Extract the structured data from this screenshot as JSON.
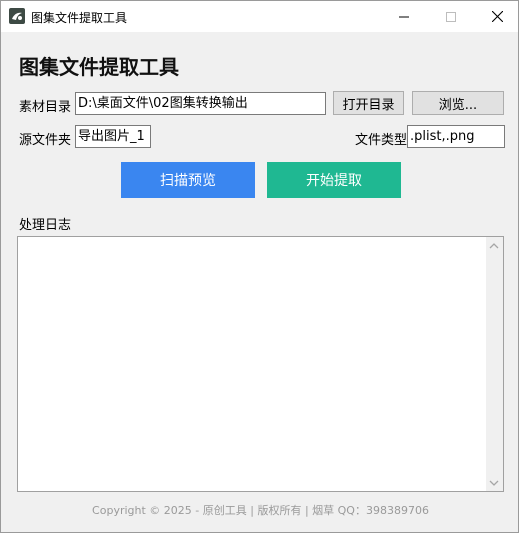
{
  "window": {
    "title": "图集文件提取工具"
  },
  "heading": "图集文件提取工具",
  "material_dir": {
    "label": "素材目录",
    "value": "D:\\桌面文件\\02图集转换输出",
    "open_button": "打开目录",
    "browse_button": "浏览..."
  },
  "source_folder": {
    "label": "源文件夹",
    "value": "导出图片_1"
  },
  "file_type": {
    "label": "文件类型",
    "value": ".plist,.png"
  },
  "actions": {
    "scan": "扫描预览",
    "start": "开始提取"
  },
  "log": {
    "label": "处理日志",
    "content": ""
  },
  "footer": "Copyright © 2025 - 原创工具 | 版权所有 | 烟草 QQ：398389706",
  "colors": {
    "scan": "#3a86f0",
    "start": "#1fb892"
  }
}
